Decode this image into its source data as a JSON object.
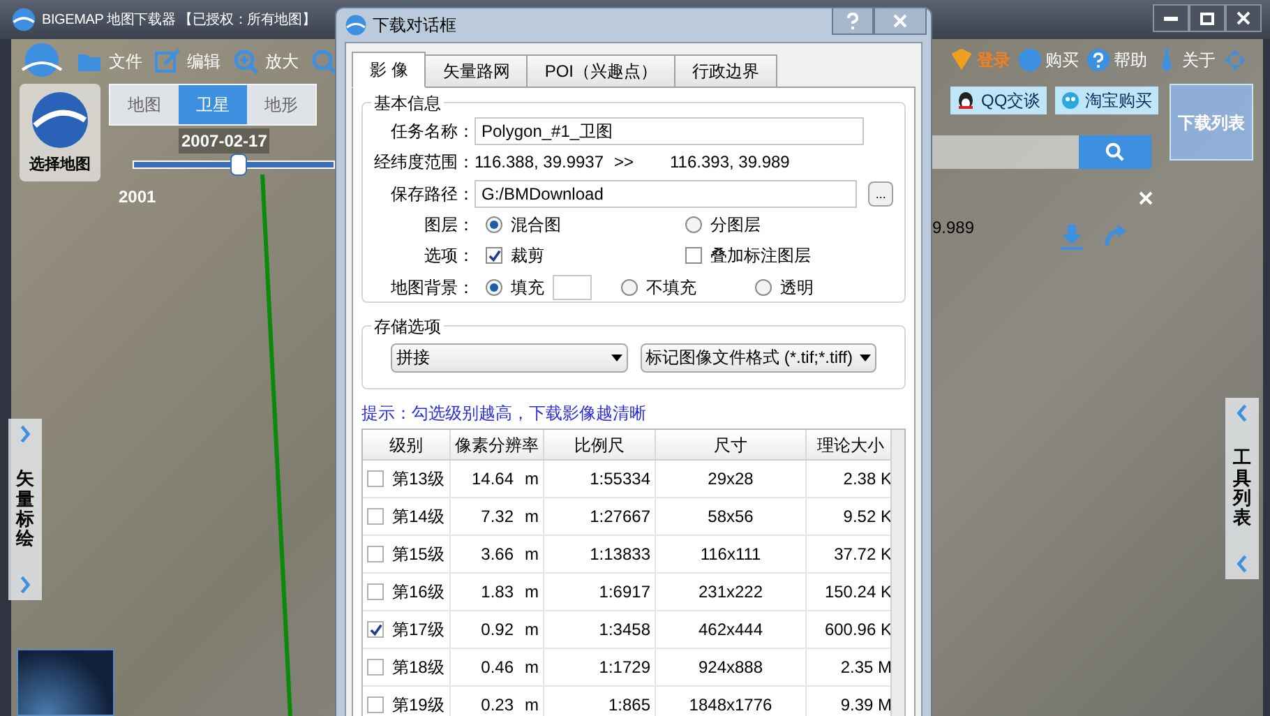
{
  "main_window": {
    "title": "BIGEMAP 地图下载器 【已授权：所有地图】"
  },
  "toolbar": {
    "left": [
      {
        "kind": "folder",
        "label": "文件"
      },
      {
        "kind": "edit",
        "label": "编辑"
      },
      {
        "kind": "zoom",
        "label": "放大"
      },
      {
        "kind": "search"
      }
    ],
    "right": [
      {
        "kind": "login",
        "label": "登录"
      },
      {
        "kind": "buy",
        "label": "购买"
      },
      {
        "kind": "help",
        "label": "帮助"
      },
      {
        "kind": "about",
        "label": "关于"
      },
      {
        "kind": "expand"
      }
    ]
  },
  "map_types": [
    {
      "label": "地图",
      "selected": false
    },
    {
      "label": "卫星",
      "selected": true
    },
    {
      "label": "地形",
      "selected": false
    }
  ],
  "map_selector": {
    "label": "选择地图"
  },
  "timeline": {
    "date": "2007-02-17",
    "start": "2001",
    "level": 0.52
  },
  "chat_buttons": [
    {
      "kind": "qq",
      "label": "QQ交谈"
    },
    {
      "kind": "taobao",
      "label": "淘宝购买"
    }
  ],
  "download_list": {
    "label": "下载列表"
  },
  "coordinate_label": "9.989",
  "left_panel": {
    "label": "矢量标绘"
  },
  "right_panel": {
    "label": "工具列表"
  },
  "dialog": {
    "title": "下载对话框",
    "tabs": [
      {
        "label": "影 像",
        "selected": true
      },
      {
        "label": "矢量路网",
        "selected": false
      },
      {
        "label": "POI（兴趣点）",
        "selected": false
      },
      {
        "label": "行政边界",
        "selected": false
      }
    ],
    "basic_info": {
      "title": "基本信息",
      "task_label": "任务名称：",
      "task_name": "Polygon_#1_卫图",
      "range_label": "经纬度范围：",
      "range_from": "116.388, 39.9937",
      "range_arrow": ">>",
      "range_to": "116.393, 39.989",
      "path_label": "保存路径：",
      "path": "G:/BMDownload",
      "browse": "...",
      "layer_label": "图层：",
      "layers": [
        {
          "label": "混合图",
          "selected": true
        },
        {
          "label": "分图层",
          "selected": false
        }
      ],
      "options_label": "选项：",
      "options": [
        {
          "label": "裁剪",
          "checked": true
        },
        {
          "label": "叠加标注图层",
          "checked": false
        }
      ],
      "background_label": "地图背景：",
      "backgrounds": [
        {
          "label": "填充",
          "selected": true
        },
        {
          "label": "不填充",
          "selected": false
        },
        {
          "label": "透明",
          "selected": false
        }
      ]
    },
    "storage": {
      "title": "存储选项",
      "mode": "拼接",
      "format": "标记图像文件格式 (*.tif;*.tiff)"
    },
    "hint": "提示：勾选级别越高，下载影像越清晰",
    "table": {
      "columns": [
        "级别",
        "像素分辨率",
        "比例尺",
        "尺寸",
        "理论大小"
      ],
      "rows": [
        {
          "level": "第13级",
          "checked": false,
          "resolution": "14.64",
          "unit": "m",
          "scale": "1:55334",
          "size": "29x28",
          "file_size": "2.38 K"
        },
        {
          "level": "第14级",
          "checked": false,
          "resolution": "7.32",
          "unit": "m",
          "scale": "1:27667",
          "size": "58x56",
          "file_size": "9.52 K"
        },
        {
          "level": "第15级",
          "checked": false,
          "resolution": "3.66",
          "unit": "m",
          "scale": "1:13833",
          "size": "116x111",
          "file_size": "37.72 K"
        },
        {
          "level": "第16级",
          "checked": false,
          "resolution": "1.83",
          "unit": "m",
          "scale": "1:6917",
          "size": "231x222",
          "file_size": "150.24 K"
        },
        {
          "level": "第17级",
          "checked": true,
          "resolution": "0.92",
          "unit": "m",
          "scale": "1:3458",
          "size": "462x444",
          "file_size": "600.96 K"
        },
        {
          "level": "第18级",
          "checked": false,
          "resolution": "0.46",
          "unit": "m",
          "scale": "1:1729",
          "size": "924x888",
          "file_size": "2.35 M"
        },
        {
          "level": "第19级",
          "checked": false,
          "resolution": "0.23",
          "unit": "m",
          "scale": "1:865",
          "size": "1848x1776",
          "file_size": "9.39 M"
        }
      ]
    }
  }
}
